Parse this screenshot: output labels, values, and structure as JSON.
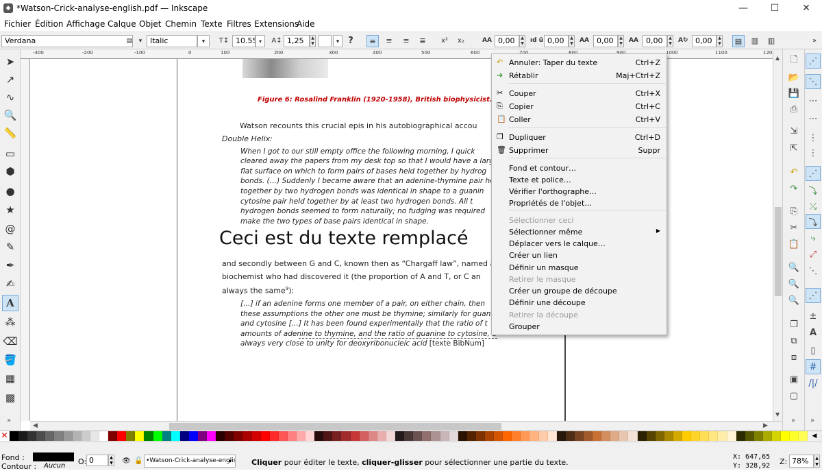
{
  "window": {
    "title": "*Watson-Crick-analyse-english.pdf — Inkscape"
  },
  "menubar": {
    "items": [
      "Fichier",
      "Édition",
      "Affichage",
      "Calque",
      "Objet",
      "Chemin",
      "Texte",
      "Filtres",
      "Extensions",
      "Aide"
    ]
  },
  "text_toolbar": {
    "font_family": "Verdana",
    "font_style": "Italic",
    "font_size": "10.55",
    "line_spacing": "1,25",
    "help_glyph": "?",
    "letter_spacing": "0,00",
    "word_spacing": "0,00",
    "kerning": "0,00",
    "vertical_shift": "0,00",
    "rotation": "0,00"
  },
  "ruler": {
    "top_ticks": [
      "-300",
      "-200",
      "-100",
      "0",
      "100",
      "200",
      "300",
      "400",
      "500",
      "600",
      "700",
      "800",
      "900",
      "1000",
      "1100",
      "1200"
    ]
  },
  "document": {
    "caption": "Figure 6: Rosalind Franklin (1920-1958), British biophysicist.",
    "intro1": "Watson recounts this crucial epis      in his autobiographical accou",
    "intro2": "Double Helix:",
    "quote1": [
      "When I got to our still empty office the following morning, I quick",
      "cleared away the papers from my desk top so that I would have a larg",
      "flat surface on which to form pairs of bases held together by hydrog",
      "bonds. (…) Suddenly I became aware that an adenine-thymine pair he",
      "together by two hydrogen bonds was identical in shape to a guanin",
      "cytosine pair held together by at least two hydrogen bonds. All t",
      "hydrogen bonds seemed to form naturally; no fudging was required",
      "make the two types of base pairs identical in shape."
    ],
    "big_text": "Ceci est du texte remplacé",
    "para2": [
      "and secondly between G and C, known then as “Chargaff law”, named af",
      "biochemist who had discovered it (the proportion of A and T, or C an"
    ],
    "para2_last": "always the same",
    "para2_sup": "9",
    "para2_end": "):",
    "quote2": [
      "[…] if an adenine forms one member of a pair, on either chain, then",
      "these assumptions the other one must be thymine; similarly for guani",
      "and cytosine […] It has been found experimentally that the ratio of t",
      "amounts of adenine to thymine, and the ratio of guanine to cytosine, a"
    ],
    "quote2_last": "always very close to unity for deoxyribonucleic acid",
    "quote2_ref": " [texte BibNum]"
  },
  "context_menu": {
    "items": [
      {
        "label": "Annuler: Taper du texte",
        "shortcut": "Ctrl+Z",
        "icon": "undo-icon",
        "disabled": false
      },
      {
        "label": "Rétablir",
        "shortcut": "Maj+Ctrl+Z",
        "icon": "redo-icon",
        "disabled": false
      },
      {
        "label": "Couper",
        "shortcut": "Ctrl+X",
        "icon": "cut-icon",
        "disabled": false
      },
      {
        "label": "Copier",
        "shortcut": "Ctrl+C",
        "icon": "copy-icon",
        "disabled": false
      },
      {
        "label": "Coller",
        "shortcut": "Ctrl+V",
        "icon": "paste-icon",
        "disabled": false
      },
      {
        "label": "Dupliquer",
        "shortcut": "Ctrl+D",
        "icon": "duplicate-icon",
        "disabled": false
      },
      {
        "label": "Supprimer",
        "shortcut": "Suppr",
        "icon": "delete-icon",
        "disabled": false
      },
      {
        "label": "Fond et contour…",
        "shortcut": "",
        "disabled": false
      },
      {
        "label": "Texte et police…",
        "shortcut": "",
        "disabled": false
      },
      {
        "label": "Vérifier l'orthographe…",
        "shortcut": "",
        "disabled": false
      },
      {
        "label": "Propriétés de l'objet…",
        "shortcut": "",
        "disabled": false
      },
      {
        "label": "Sélectionner ceci",
        "shortcut": "",
        "disabled": true
      },
      {
        "label": "Sélectionner même",
        "shortcut": "",
        "submenu": true,
        "disabled": false
      },
      {
        "label": "Déplacer vers le calque…",
        "shortcut": "",
        "disabled": false
      },
      {
        "label": "Créer un lien",
        "shortcut": "",
        "disabled": false
      },
      {
        "label": "Définir un masque",
        "shortcut": "",
        "disabled": false
      },
      {
        "label": "Retirer le masque",
        "shortcut": "",
        "disabled": true
      },
      {
        "label": "Créer un groupe de découpe",
        "shortcut": "",
        "disabled": false
      },
      {
        "label": "Définir une découpe",
        "shortcut": "",
        "disabled": false
      },
      {
        "label": "Retirer la découpe",
        "shortcut": "",
        "disabled": true
      },
      {
        "label": "Grouper",
        "shortcut": "",
        "disabled": false
      }
    ]
  },
  "status": {
    "fill_label": "Fond :",
    "stroke_label": "Contour :",
    "stroke_value": "Aucun",
    "opacity_label": "O:",
    "opacity_value": "0",
    "layer": "•Watson-Crick-analyse-english",
    "message_b1": "Cliquer",
    "message_t1": " pour éditer le texte, ",
    "message_b2": "cliquer-glisser",
    "message_t2": " pour sélectionner une partie du texte.",
    "x": "X:  647,65",
    "y": "Y:  328,92",
    "zoom_label": "Z:",
    "zoom": "78%"
  },
  "colors": {
    "accent": "#7aa7d6",
    "caption_red": "#c00000",
    "selection_bg": "#cde4f7"
  },
  "palette": [
    "#000000",
    "#1a1a1a",
    "#333333",
    "#4d4d4d",
    "#666666",
    "#808080",
    "#999999",
    "#b3b3b3",
    "#cccccc",
    "#e6e6e6",
    "#ffffff",
    "#800000",
    "#ff0000",
    "#808000",
    "#ffff00",
    "#008000",
    "#00ff00",
    "#008080",
    "#00ffff",
    "#000080",
    "#0000ff",
    "#800080",
    "#ff00ff",
    "#2b0000",
    "#550000",
    "#800000",
    "#aa0000",
    "#d40000",
    "#ff0000",
    "#ff2a2a",
    "#ff5555",
    "#ff8080",
    "#ffaaaa",
    "#ffd5d5",
    "#280b0b",
    "#501616",
    "#782121",
    "#a02c2c",
    "#c83737",
    "#d35f5f",
    "#de8787",
    "#e9afaf",
    "#f4d7d7",
    "#241c1c",
    "#483737",
    "#6c5353",
    "#916f6f",
    "#ac9393",
    "#c8b7b7",
    "#e3dbdb",
    "#2b1100",
    "#552200",
    "#803300",
    "#aa4400",
    "#d45500",
    "#ff6600",
    "#ff7f2a",
    "#ff9955",
    "#ffb380",
    "#ffccaa",
    "#ffe6d5",
    "#28170b",
    "#502d16",
    "#784421",
    "#a05a2c",
    "#c87137",
    "#d38d5f",
    "#deaa87",
    "#e9c6af",
    "#f4e3d7",
    "#2b2200",
    "#554400",
    "#806600",
    "#aa8800",
    "#d4aa00",
    "#ffcc00",
    "#ffd42a",
    "#ffdd55",
    "#ffe680",
    "#ffeeaa",
    "#fff6d5",
    "#2b2b00",
    "#555500",
    "#808000",
    "#aaaa00",
    "#d4d400",
    "#ffff00",
    "#ffff2a",
    "#ffff55"
  ],
  "toolbox": [
    "selector-icon",
    "node-icon",
    "tweak-icon",
    "zoom-icon",
    "measure-icon",
    "rect-icon",
    "3dbox-icon",
    "ellipse-icon",
    "star-icon",
    "spiral-icon",
    "pencil-icon",
    "pen-icon",
    "calligraphy-icon",
    "text-icon",
    "spray-icon",
    "eraser-icon",
    "bucket-icon",
    "gradient-icon",
    "mesh-icon"
  ],
  "commands": [
    "new-icon",
    "open-icon",
    "save-icon",
    "print-icon",
    "import-icon",
    "export-icon",
    "undo-icon",
    "redo-icon",
    "copy-icon",
    "cut-icon",
    "paste-icon",
    "zoom-selection-icon",
    "zoom-drawing-icon",
    "zoom-page-icon",
    "duplicate-icon",
    "clone-icon",
    "unlink-clone-icon",
    "group-icon",
    "ungroup-icon",
    "fill-stroke-icon",
    "text-font-icon",
    "xml-editor-icon",
    "align-icon"
  ]
}
